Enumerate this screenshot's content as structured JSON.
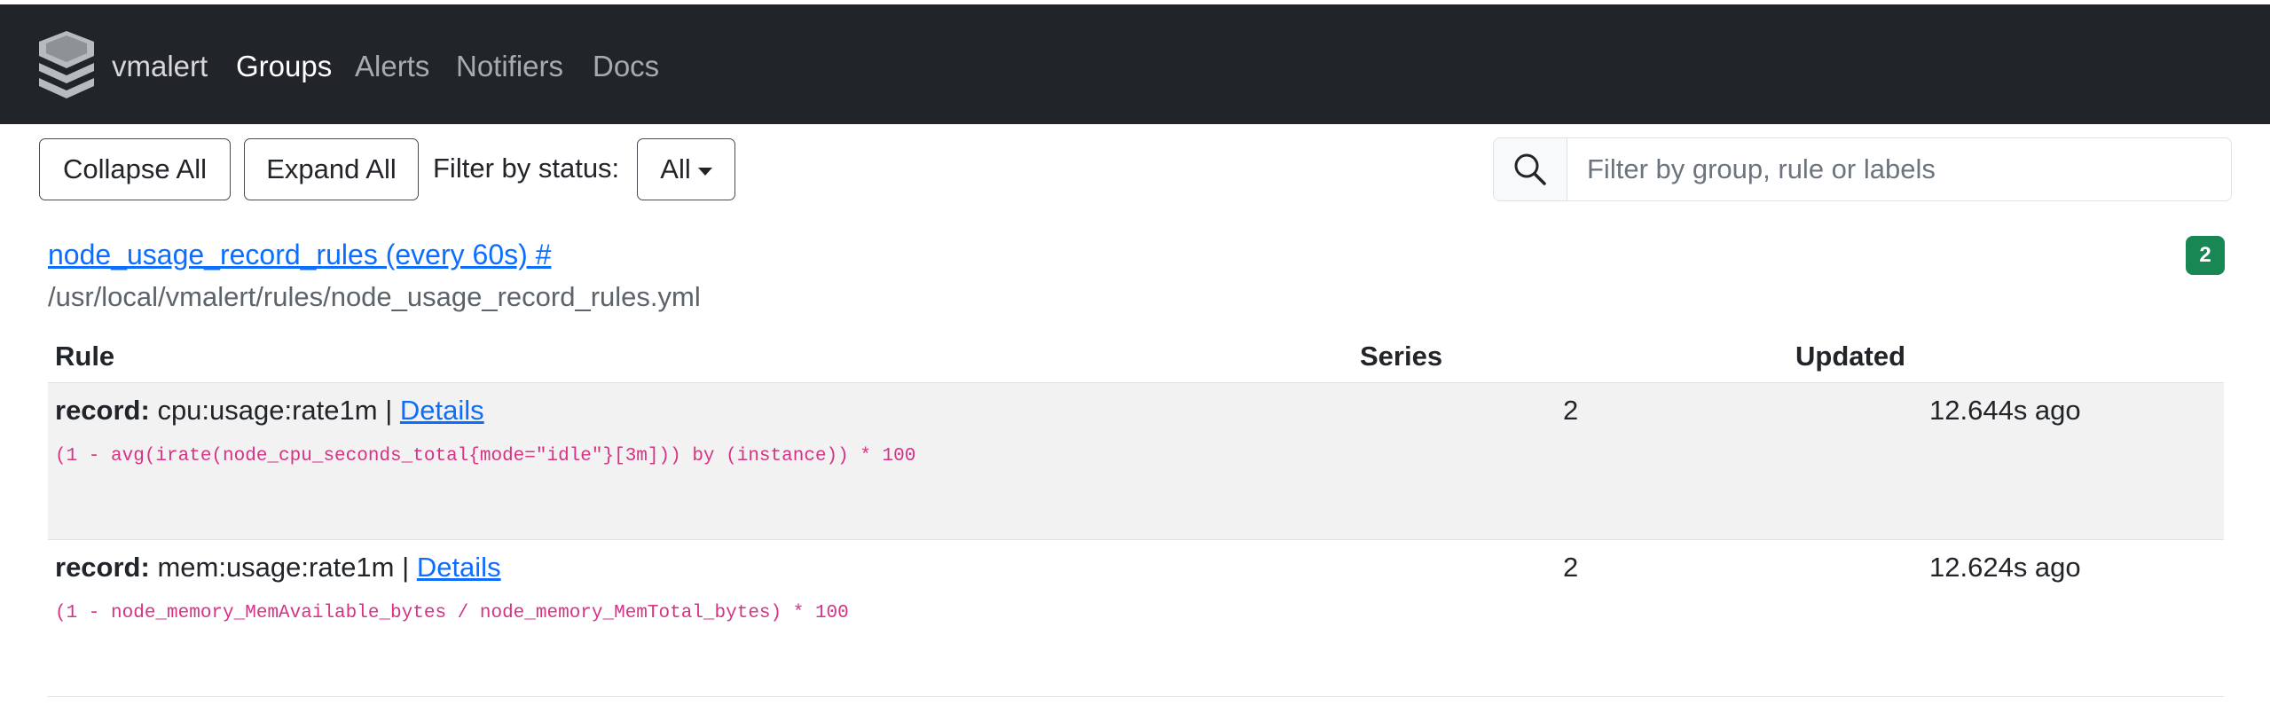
{
  "navbar": {
    "brand": "vmalert",
    "links": [
      {
        "label": "Groups",
        "active": true
      },
      {
        "label": "Alerts",
        "active": false
      },
      {
        "label": "Notifiers",
        "active": false
      },
      {
        "label": "Docs",
        "active": false
      }
    ]
  },
  "toolbar": {
    "collapse_label": "Collapse All",
    "expand_label": "Expand All",
    "filter_status_label": "Filter by status:",
    "status_selected": "All",
    "search_placeholder": "Filter by group, rule or labels"
  },
  "group": {
    "title": "node_usage_record_rules (every 60s) #",
    "file": "/usr/local/vmalert/rules/node_usage_record_rules.yml",
    "badge_count": "2",
    "badge_color": "#198754"
  },
  "table": {
    "headers": {
      "rule": "Rule",
      "series": "Series",
      "updated": "Updated"
    },
    "rows": [
      {
        "type_label": "record:",
        "name": "cpu:usage:rate1m",
        "separator": "|",
        "details_label": "Details",
        "expr": "(1 - avg(irate(node_cpu_seconds_total{mode=\"idle\"}[3m])) by (instance)) * 100",
        "series": "2",
        "updated": "12.644s ago"
      },
      {
        "type_label": "record:",
        "name": "mem:usage:rate1m",
        "separator": "|",
        "details_label": "Details",
        "expr": "(1 - node_memory_MemAvailable_bytes / node_memory_MemTotal_bytes) * 100",
        "series": "2",
        "updated": "12.624s ago"
      }
    ]
  },
  "colors": {
    "navbar_bg": "#212529",
    "link": "#0d6efd",
    "expr": "#d63384",
    "row_stripe": "#f2f2f2"
  },
  "icons": {
    "logo": "vmalert-logo-icon",
    "search": "search-icon",
    "dropdown": "caret-down-icon"
  }
}
